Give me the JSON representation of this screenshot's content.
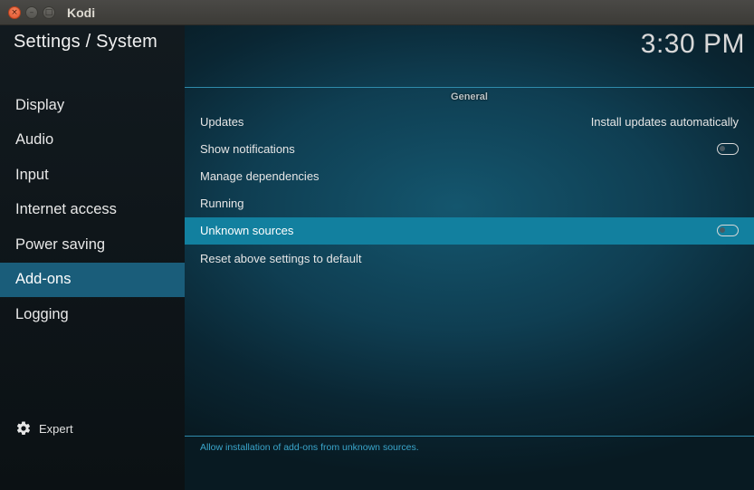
{
  "window": {
    "title": "Kodi",
    "close_glyph": "×",
    "min_glyph": "–",
    "max_glyph": "□"
  },
  "sidebar": {
    "title": "Settings / System",
    "items": [
      {
        "label": "Display",
        "active": false
      },
      {
        "label": "Audio",
        "active": false
      },
      {
        "label": "Input",
        "active": false
      },
      {
        "label": "Internet access",
        "active": false
      },
      {
        "label": "Power saving",
        "active": false
      },
      {
        "label": "Add-ons",
        "active": true
      },
      {
        "label": "Logging",
        "active": false
      }
    ],
    "level_label": "Expert",
    "level_icon": "gear-icon"
  },
  "main": {
    "clock": "3:30 PM",
    "section_title": "General",
    "rows": [
      {
        "label": "Updates",
        "value": "Install updates automatically"
      },
      {
        "label": "Show notifications",
        "toggle": "off"
      },
      {
        "label": "Manage dependencies"
      },
      {
        "label": "Running"
      },
      {
        "label": "Unknown sources",
        "toggle": "off",
        "focused": true
      },
      {
        "label": "Reset above settings to default"
      }
    ],
    "help_text": "Allow installation of add-ons from unknown sources."
  },
  "colors": {
    "accent": "#12809f",
    "sidebar_active": "#1a5d7a",
    "help_text": "#3aa6cc"
  }
}
